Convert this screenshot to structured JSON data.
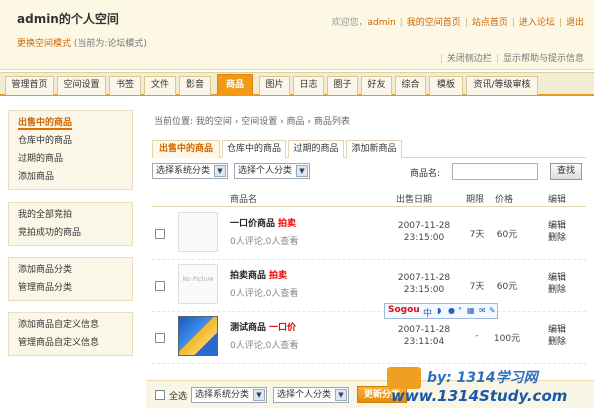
{
  "header": {
    "title": "admin的个人空间",
    "change_style": "更换空间模式",
    "current_mode": "(当前为:论坛模式)",
    "welcome": "欢迎您，",
    "username": "admin",
    "links": [
      "我的空间首页",
      "站点首页",
      "进入论坛",
      "退出"
    ],
    "toolbar": [
      "关闭侧边栏",
      "显示帮助与提示信息"
    ]
  },
  "nav": {
    "tabs": [
      "管理首页",
      "空间设置",
      "书签",
      "文件",
      "影音",
      "商品",
      "图片",
      "日志",
      "圈子",
      "好友",
      "综合",
      "模板",
      "资讯/等级审核"
    ],
    "active": "商品"
  },
  "sidebar": {
    "groups": [
      [
        "出售中的商品",
        "仓库中的商品",
        "过期的商品",
        "添加商品"
      ],
      [
        "我的全部竞拍",
        "竞拍成功的商品"
      ],
      [
        "添加商品分类",
        "管理商品分类"
      ],
      [
        "添加商品自定义信息",
        "管理商品自定义信息"
      ]
    ]
  },
  "main": {
    "breadcrumb": "当前位置: 我的空间 › 空间设置 › 商品 › 商品列表",
    "subtabs": [
      "出售中的商品",
      "仓库中的商品",
      "过期的商品",
      "添加新商品"
    ],
    "filter": {
      "sys_category": "选择系统分类",
      "personal_category": "选择个人分类",
      "name_label": "商品名:",
      "name_value": "",
      "search_label": "查找"
    },
    "columns": [
      "商品名",
      "出售日期",
      "期限",
      "价格",
      "编辑"
    ],
    "products": [
      {
        "name": "一口价商品",
        "tag": "拍卖",
        "meta": "0人评论,0人查看",
        "date": "2007-11-28",
        "time": "23:15:00",
        "term": "7天",
        "price": "60元",
        "edit": "编辑",
        "delete": "删除",
        "thumb_text": ""
      },
      {
        "name": "拍卖商品",
        "tag": "拍卖",
        "meta": "0人评论,0人查看",
        "date": "2007-11-28",
        "time": "23:15:00",
        "term": "7天",
        "price": "60元",
        "edit": "编辑",
        "delete": "删除",
        "thumb_text": "No Picture"
      },
      {
        "name": "测试商品",
        "tag": "一口价",
        "meta": "0人评论,0人查看",
        "date": "2007-11-28",
        "time": "23:11:04",
        "term": "-",
        "price": "100元",
        "edit": "编辑",
        "delete": "删除",
        "thumb_text": ""
      }
    ],
    "bottom": {
      "select_all": "全选",
      "sys_category": "选择系统分类",
      "personal_category": "选择个人分类",
      "update_button": "更新分类"
    }
  },
  "overlay": {
    "sogou_logo": "Sogou",
    "sogou_text": "中",
    "watermark_line1": "by: 1314学习网",
    "watermark_line2": "www.1314Study.com"
  }
}
